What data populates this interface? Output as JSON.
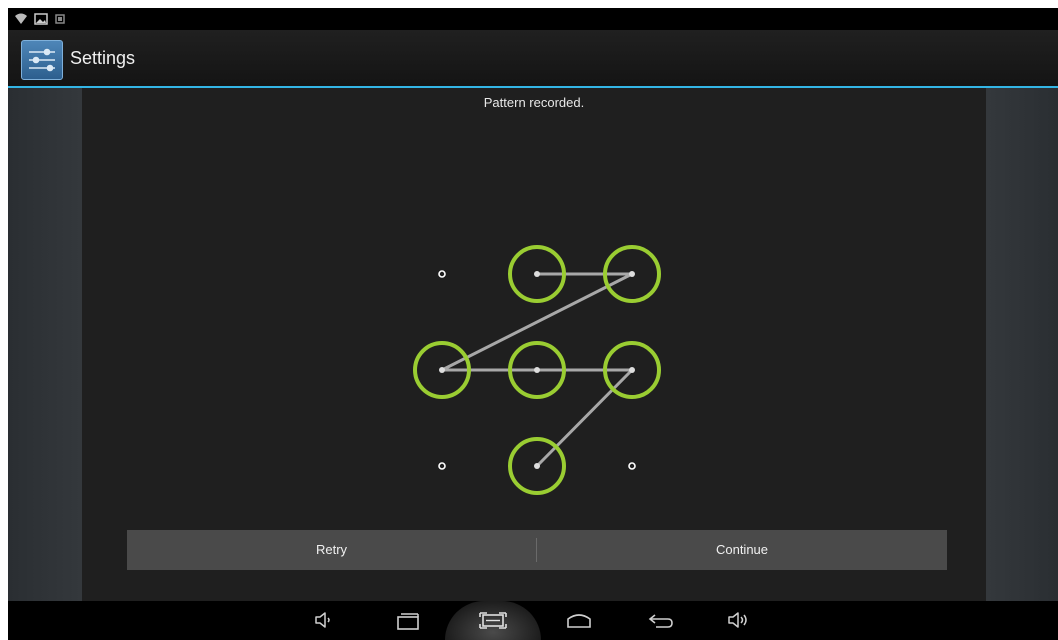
{
  "status_bar": {
    "icons": [
      "wifi-icon",
      "image-icon",
      "notification-icon"
    ]
  },
  "action_bar": {
    "title": "Settings",
    "icon": "settings-sliders-icon"
  },
  "lock_pattern": {
    "header_message": "Pattern recorded.",
    "grid": "3x3",
    "selected_sequence": [
      2,
      3,
      4,
      5,
      6,
      8
    ],
    "selected_color": "#9acd32"
  },
  "buttons": {
    "retry_label": "Retry",
    "continue_label": "Continue"
  },
  "nav_bar": {
    "icons": [
      "volume-down-icon",
      "recent-apps-icon",
      "screenshot-icon",
      "home-icon",
      "back-icon",
      "volume-up-icon"
    ]
  },
  "colors": {
    "accent": "#33b5e5",
    "pattern_ring": "#9acd32",
    "panel_bg": "#1f1f1f"
  }
}
